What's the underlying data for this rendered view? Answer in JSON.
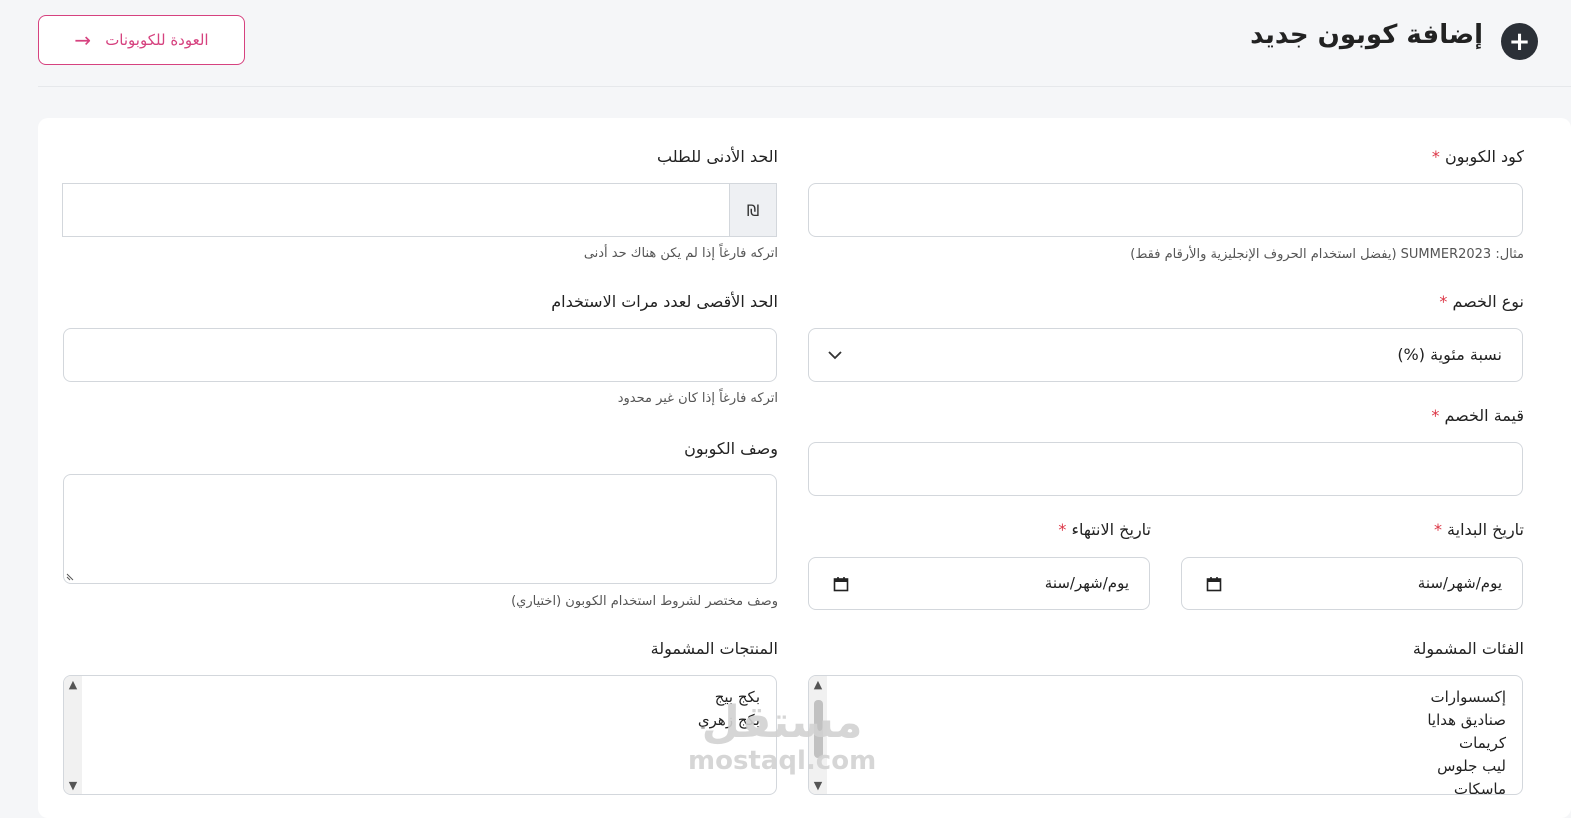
{
  "header": {
    "title": "إضافة كوبون جديد",
    "plus_icon": "+",
    "back_label": "العودة للكوبونات",
    "back_icon": "→"
  },
  "form": {
    "coupon_code": {
      "label": "كود الكوبون",
      "required_mark": "*",
      "value": "",
      "help": "مثال: SUMMER2023 (يفضل استخدام الحروف الإنجليزية والأرقام فقط)"
    },
    "min_order": {
      "label": "الحد الأدنى للطلب",
      "currency": "₪",
      "value": "",
      "help": "اتركه فارغاً إذا لم يكن هناك حد أدنى"
    },
    "discount_type": {
      "label": "نوع الخصم",
      "required_mark": "*",
      "selected": "نسبة مئوية (%)"
    },
    "max_uses": {
      "label": "الحد الأقصى لعدد مرات الاستخدام",
      "value": "",
      "help": "اتركه فارغاً إذا كان غير محدود"
    },
    "discount_value": {
      "label": "قيمة الخصم",
      "required_mark": "*",
      "value": ""
    },
    "description": {
      "label": "وصف الكوبون",
      "value": "",
      "help": "وصف مختصر لشروط استخدام الكوبون (اختياري)"
    },
    "start_date": {
      "label": "تاريخ البداية",
      "required_mark": "*",
      "placeholder": "يوم/شهر/سنة"
    },
    "end_date": {
      "label": "تاريخ الانتهاء",
      "required_mark": "*",
      "placeholder": "يوم/شهر/سنة"
    },
    "categories": {
      "label": "الفئات المشمولة",
      "options": [
        "إكسسوارات",
        "صناديق هدايا",
        "كريمات",
        "ليب جلوس",
        "ماسكات"
      ]
    },
    "products": {
      "label": "المنتجات المشمولة",
      "options": [
        "بكج بيج",
        "بكج زهري"
      ]
    }
  },
  "watermark": {
    "arabic": "مستقل",
    "latin": "mostaql.com"
  },
  "icons": {
    "calendar": "calendar-icon",
    "chevron": "chevron-down-icon",
    "resize": "resize-handle-icon"
  },
  "colors": {
    "accent": "#d6427f",
    "required": "#dc3545",
    "dark": "#2b3037"
  }
}
